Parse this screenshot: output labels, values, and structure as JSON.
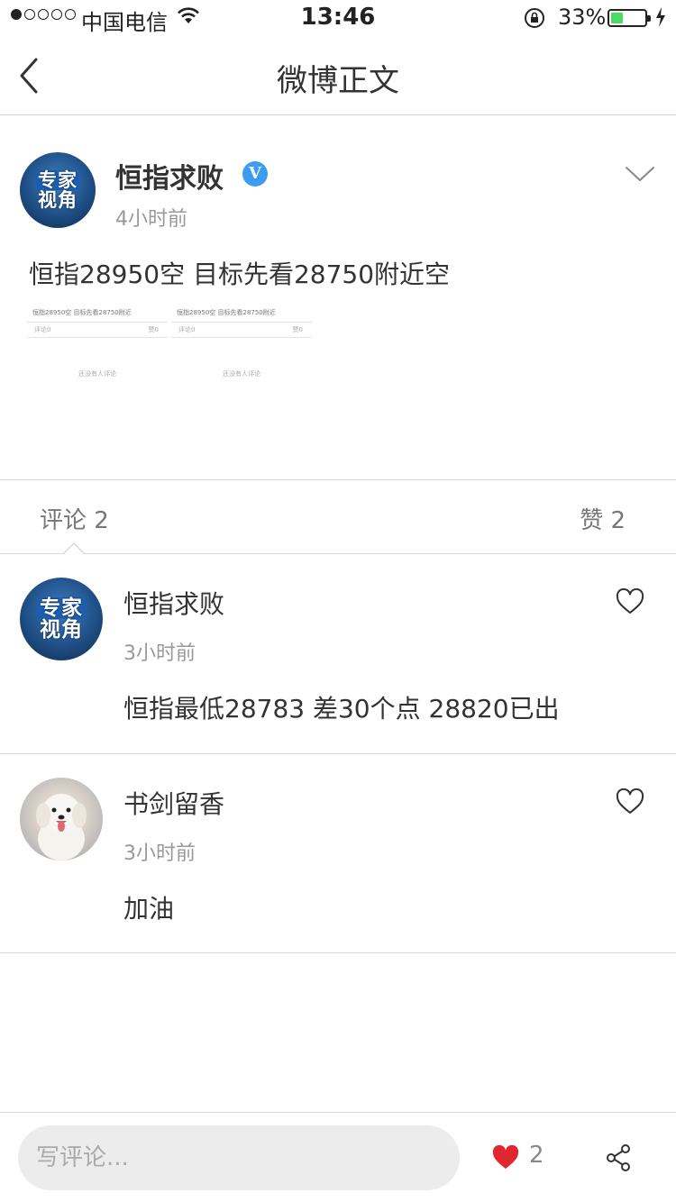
{
  "status_bar": {
    "carrier": "中国电信",
    "time": "13:46",
    "battery": "33%",
    "battery_level": 0.33,
    "signal_bars": 1
  },
  "nav": {
    "title": "微博正文",
    "back_icon": "chevron-left-icon"
  },
  "post": {
    "author": "恒指求败",
    "verified_label": "V",
    "time": "4小时前",
    "text": "恒指28950空 目标先看28750附近空",
    "avatar_text": [
      "专家",
      "视角"
    ],
    "thumbnails": [
      {
        "title": "恒指28950空 目标先看28750附近",
        "comment_label": "评论0",
        "like_label": "赞0",
        "empty_text": "还没有人评论"
      },
      {
        "title": "恒指28950空 目标先看28750附近",
        "comment_label": "评论0",
        "like_label": "赞0",
        "empty_text": "还没有人评论"
      }
    ]
  },
  "tabs": {
    "comments": "评论 2",
    "likes": "赞 2"
  },
  "comments": [
    {
      "name": "恒指求败",
      "time": "3小时前",
      "text": "恒指最低28783 差30个点 28820已出",
      "avatar": "expert",
      "avatar_text": [
        "专家",
        "视角"
      ]
    },
    {
      "name": "书剑留香",
      "time": "3小时前",
      "text": "加油",
      "avatar": "dog"
    }
  ],
  "bottom_bar": {
    "input_placeholder": "写评论...",
    "like_count": "2",
    "colors": {
      "heart": "#e0262e"
    }
  }
}
